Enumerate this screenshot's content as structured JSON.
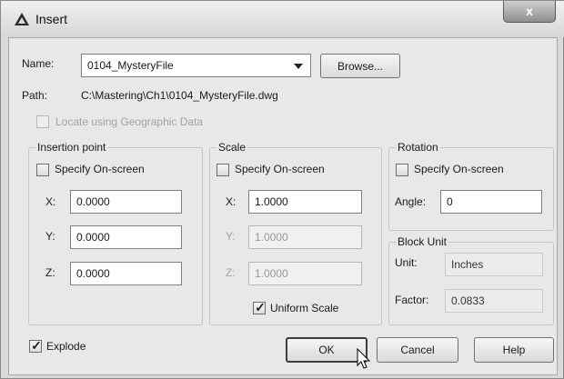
{
  "window": {
    "title": "Insert",
    "close_glyph": "x"
  },
  "name": {
    "label": "Name:",
    "value": "0104_MysteryFile",
    "browse_label": "Browse..."
  },
  "path": {
    "label": "Path:",
    "value": "C:\\Mastering\\Ch1\\0104_MysteryFile.dwg"
  },
  "geo": {
    "label": "Locate using Geographic Data",
    "checked": false,
    "enabled": false
  },
  "insertion_point": {
    "title": "Insertion point",
    "specify_label": "Specify On-screen",
    "x_label": "X:",
    "x": "0.0000",
    "y_label": "Y:",
    "y": "0.0000",
    "z_label": "Z:",
    "z": "0.0000"
  },
  "scale": {
    "title": "Scale",
    "specify_label": "Specify On-screen",
    "x_label": "X:",
    "x": "1.0000",
    "y_label": "Y:",
    "y": "1.0000",
    "z_label": "Z:",
    "z": "1.0000",
    "uniform_label": "Uniform Scale",
    "uniform_checked": true
  },
  "rotation": {
    "title": "Rotation",
    "specify_label": "Specify On-screen",
    "angle_label": "Angle:",
    "angle": "0"
  },
  "block_unit": {
    "title": "Block Unit",
    "unit_label": "Unit:",
    "unit": "Inches",
    "factor_label": "Factor:",
    "factor": "0.0833"
  },
  "explode": {
    "label": "Explode",
    "checked": true
  },
  "buttons": {
    "ok": "OK",
    "cancel": "Cancel",
    "help": "Help"
  },
  "colors": {
    "background": "#e8e8e8",
    "text": "#1a1a1a",
    "disabled": "#a3a3a3"
  },
  "icons": [
    "autocad-logo-icon",
    "close-icon",
    "dropdown-arrow-icon",
    "checkmark-icon",
    "mouse-pointer-icon"
  ]
}
